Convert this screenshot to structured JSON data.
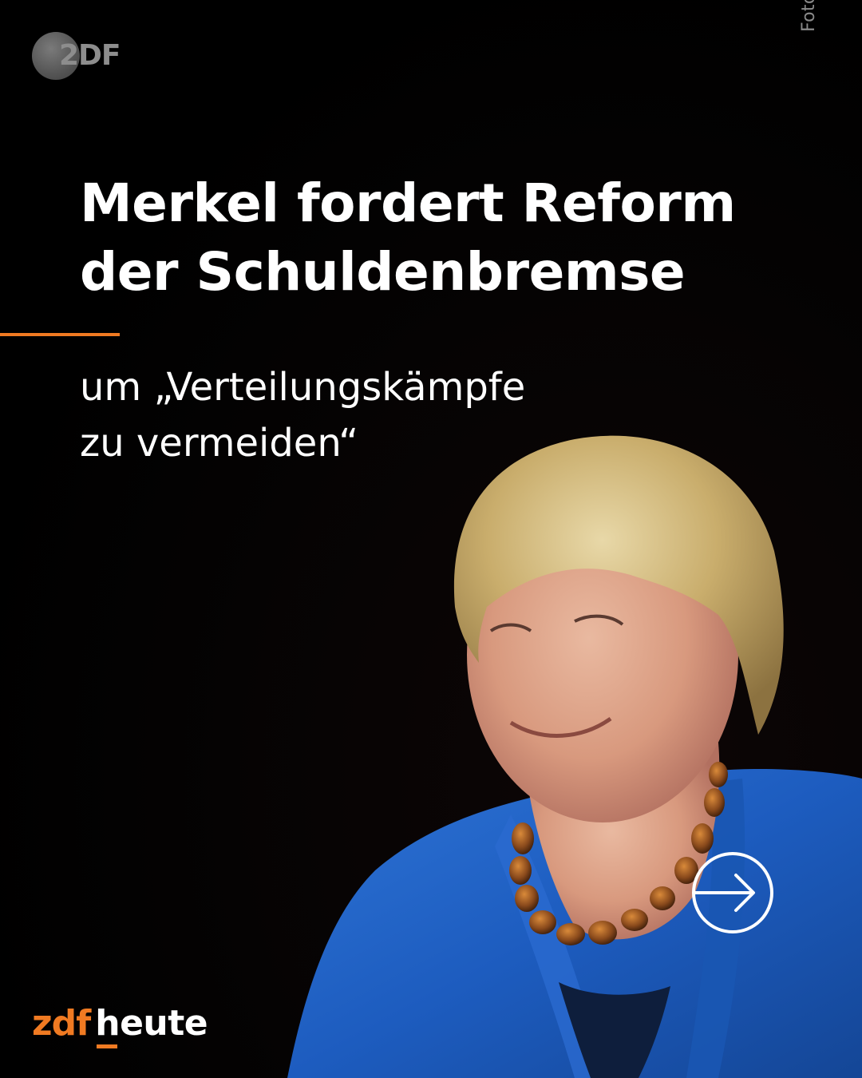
{
  "logo": {
    "text": "2DF"
  },
  "headline": {
    "line1": "Merkel fordert Reform",
    "line2": "der Schuldenbremse"
  },
  "subline": {
    "line1": "um „Verteilungskämpfe",
    "line2": "zu vermeiden“"
  },
  "credit": "Foto: Reuters/Annegret Hilse, Archivbild",
  "brand": {
    "zdf": "zdf",
    "heute": "heute"
  },
  "icons": {
    "next": "arrow-right-circle-icon"
  },
  "colors": {
    "background": "#000000",
    "accent": "#f07a22",
    "headline": "#ffffff",
    "credit": "#8a8a8a",
    "jacket": "#1f5fbf"
  }
}
